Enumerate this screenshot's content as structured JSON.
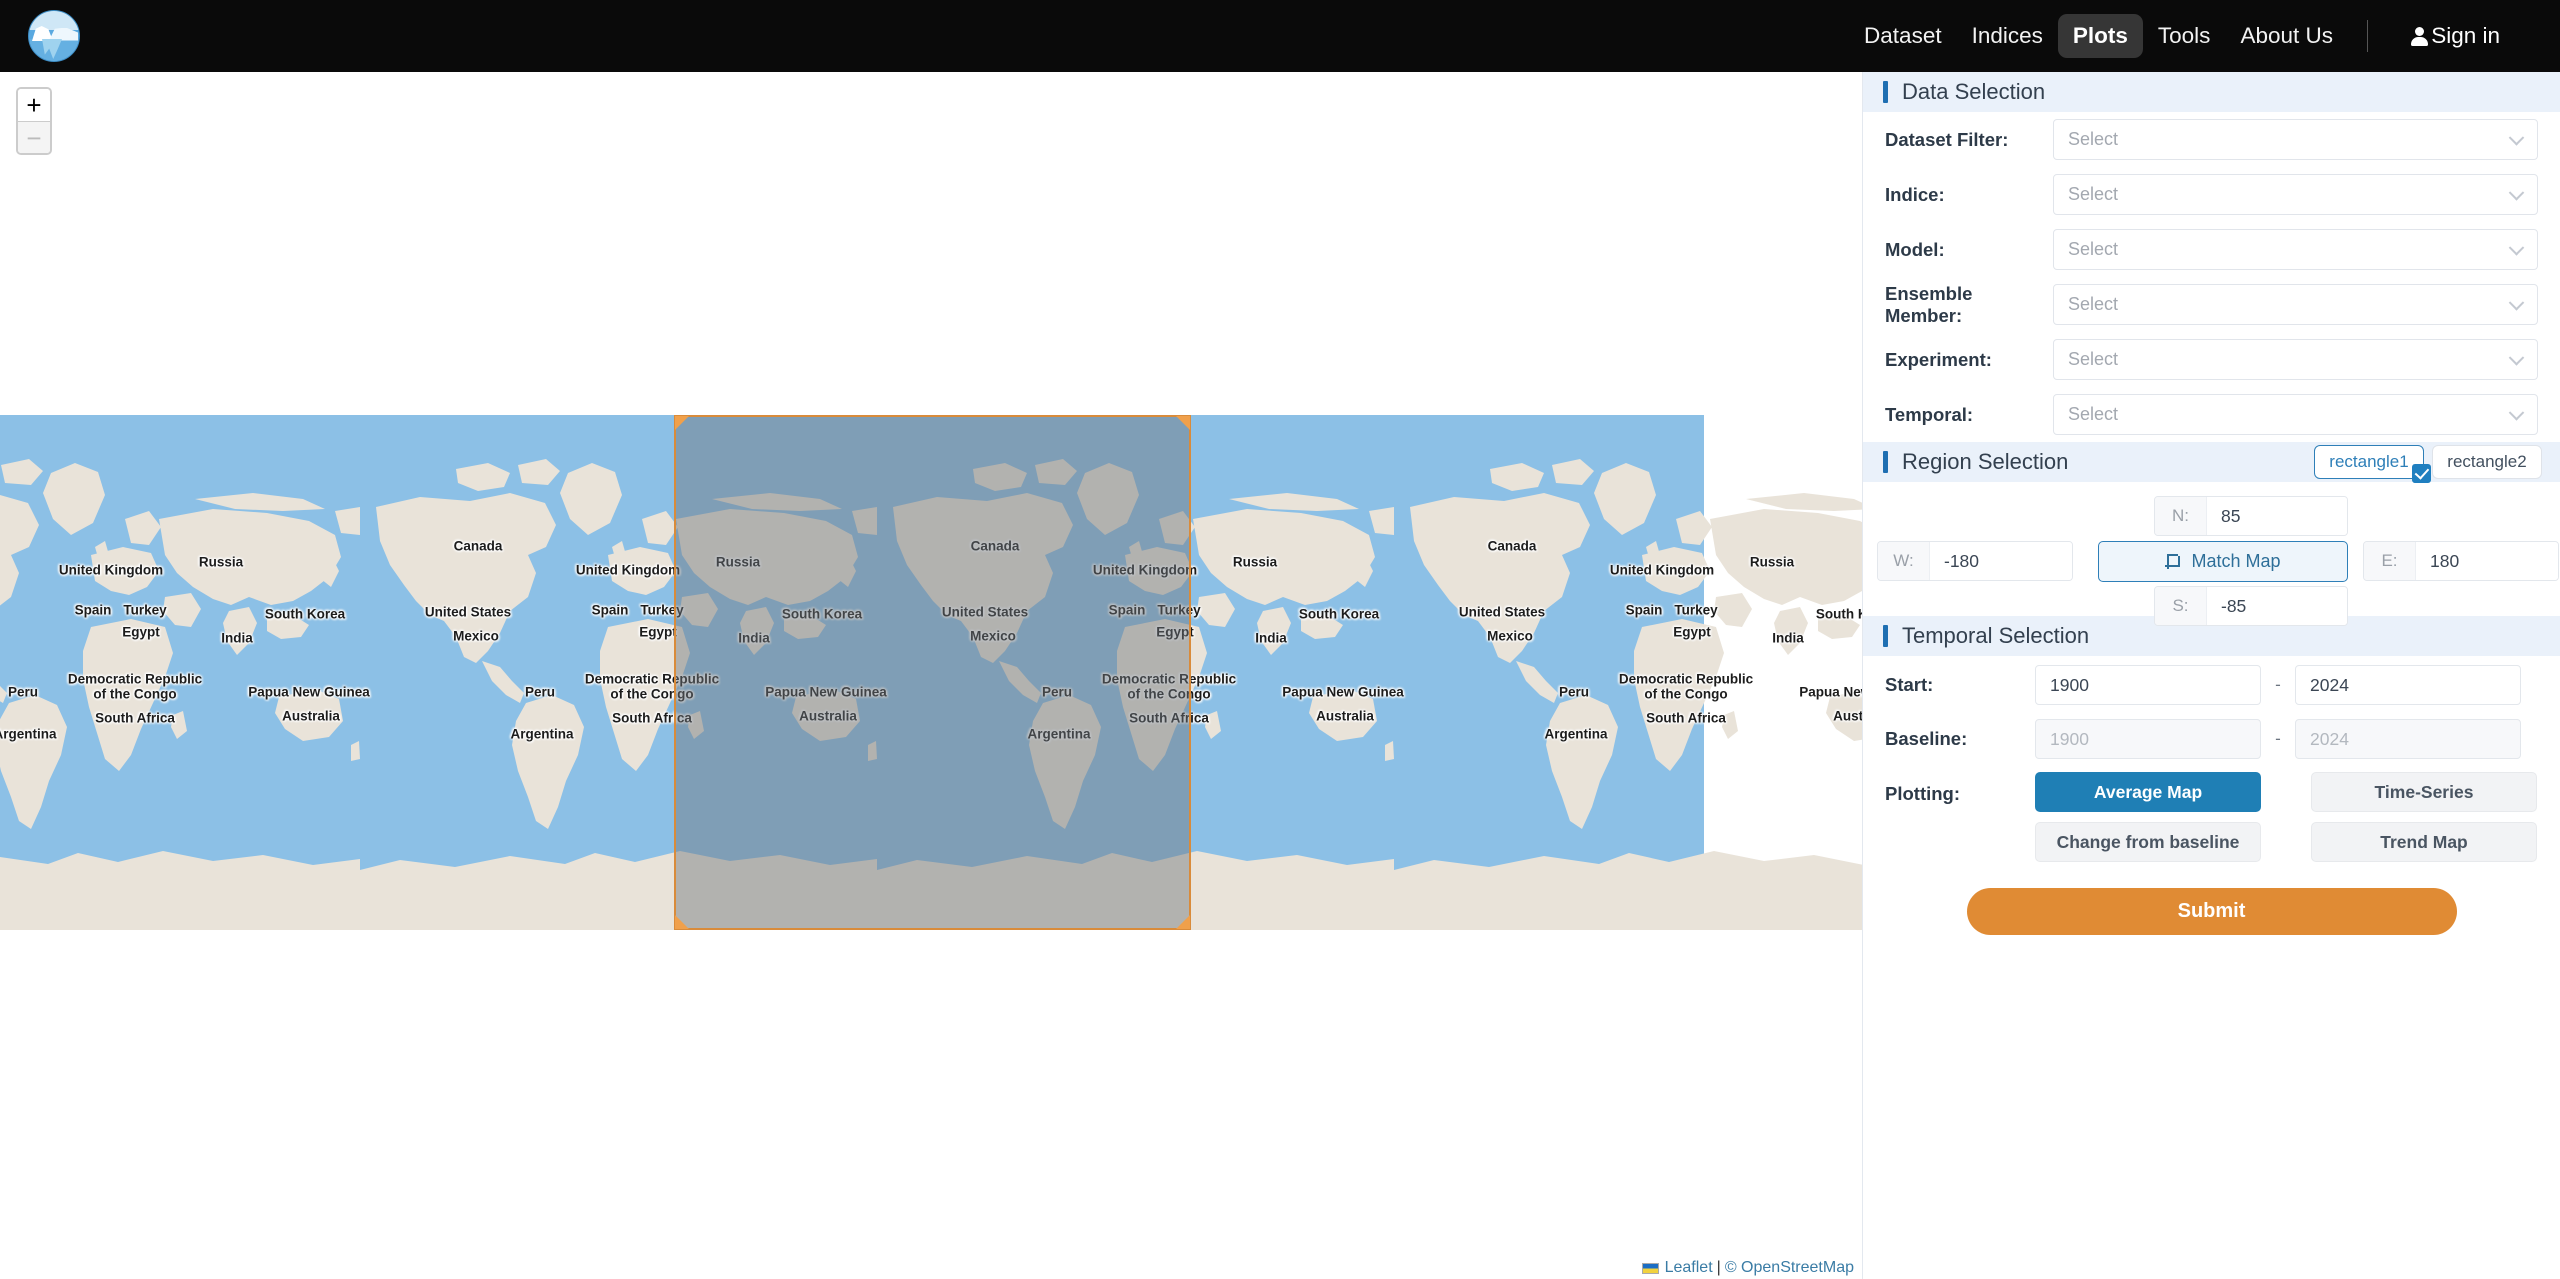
{
  "nav": {
    "brand_icon": "globe-iceberg-logo",
    "links": [
      {
        "label": "Dataset",
        "active": false
      },
      {
        "label": "Indices",
        "active": false
      },
      {
        "label": "Plots",
        "active": true
      },
      {
        "label": "Tools",
        "active": false
      },
      {
        "label": "About Us",
        "active": false
      }
    ],
    "signin_label": "Sign in",
    "signin_icon": "person-icon"
  },
  "map": {
    "zoom_in_label": "+",
    "zoom_out_label": "−",
    "attribution": {
      "leaflet": "Leaflet",
      "separator": "|",
      "osm": "© OpenStreetMap"
    },
    "labels": [
      "Russia",
      "Canada",
      "United Kingdom",
      "United States",
      "Spain",
      "Turkey",
      "South Korea",
      "Mexico",
      "Egypt",
      "India",
      "Democratic Republic",
      "of the Congo",
      "Papua New Guinea",
      "Peru",
      "Australia",
      "South Africa",
      "Argentina"
    ],
    "colors": {
      "ocean": "#8cc0e6",
      "land": "#e9e3d9",
      "selection_fill": "rgba(110,118,125,0.45)",
      "selection_border": "#d98b3a",
      "handle": "#f0a04b"
    }
  },
  "panel": {
    "data_selection": {
      "title": "Data Selection",
      "fields": [
        {
          "label": "Dataset Filter:",
          "value": "",
          "placeholder": "Select"
        },
        {
          "label": "Indice:",
          "value": "",
          "placeholder": "Select"
        },
        {
          "label": "Model:",
          "value": "",
          "placeholder": "Select"
        },
        {
          "label": "Ensemble Member:",
          "value": "",
          "placeholder": "Select"
        },
        {
          "label": "Experiment:",
          "value": "",
          "placeholder": "Select"
        },
        {
          "label": "Temporal:",
          "value": "",
          "placeholder": "Select"
        }
      ]
    },
    "region_selection": {
      "title": "Region Selection",
      "tabs": [
        {
          "label": "rectangle1",
          "active": true
        },
        {
          "label": "rectangle2",
          "active": false
        }
      ],
      "coords": {
        "n_key": "N:",
        "n_value": "85",
        "s_key": "S:",
        "s_value": "-85",
        "w_key": "W:",
        "w_value": "-180",
        "e_key": "E:",
        "e_value": "180"
      },
      "match_map_label": "Match Map"
    },
    "temporal_selection": {
      "title": "Temporal Selection",
      "start_label": "Start:",
      "start_from": "1900",
      "start_to": "2024",
      "baseline_label": "Baseline:",
      "baseline_from": "1900",
      "baseline_to": "2024",
      "range_dash": "-",
      "plotting_label": "Plotting:",
      "plot_buttons": [
        {
          "label": "Average Map",
          "active": true
        },
        {
          "label": "Time-Series",
          "active": false
        },
        {
          "label": "Change from baseline",
          "active": false
        },
        {
          "label": "Trend Map",
          "active": false
        }
      ],
      "submit_label": "Submit"
    }
  },
  "theme": {
    "accent_blue": "#1f6fb2",
    "primary_blue": "#1f7fb5",
    "submit_orange": "#e08b34",
    "nav_black": "#0a0a0a"
  }
}
